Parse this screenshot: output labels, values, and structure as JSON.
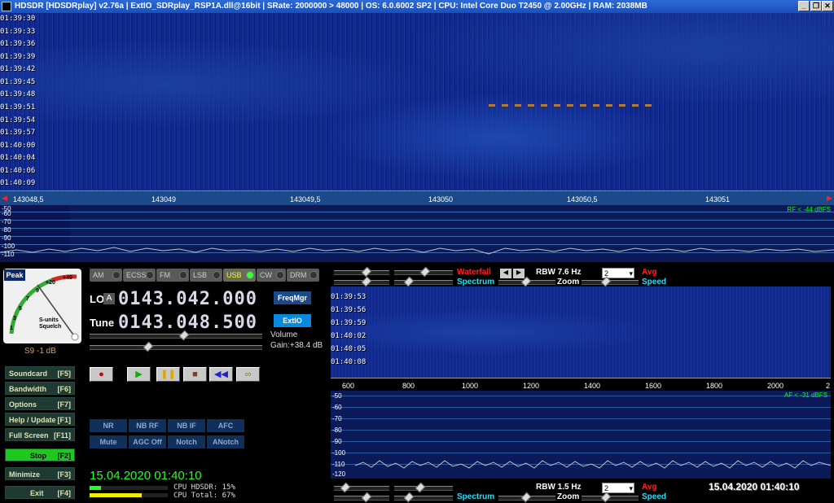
{
  "title": "HDSDR [HDSDRplay]  v2.76a  |  ExtIO_SDRplay_RSP1A.dll@16bit  |  SRate: 2000000 > 48000  |  OS: 6.0.6002 SP2  |  CPU: Intel Core Duo      T2450  @ 2.00GHz  |  RAM: 2038MB",
  "window_buttons": [
    "_",
    "❐",
    "✕"
  ],
  "waterfall_top": {
    "timestamps": [
      "01:39:30",
      "01:39:33",
      "01:39:36",
      "01:39:39",
      "01:39:42",
      "01:39:45",
      "01:39:48",
      "01:39:51",
      "01:39:54",
      "01:39:57",
      "01:40:00",
      "01:40:04",
      "01:40:06",
      "01:40:09"
    ]
  },
  "freq_axis": [
    "143048,5",
    "143049",
    "143049,5",
    "143050",
    "143050,5",
    "143051"
  ],
  "rf_spectrum": {
    "status": "RF < -44 dBFS",
    "db_labels": [
      "-50",
      "-60",
      "-70",
      "-80",
      "-90",
      "-100",
      "-110"
    ]
  },
  "meter": {
    "peak": "Peak",
    "scale": [
      "+40",
      "+20",
      "9",
      "7",
      "5",
      "3",
      "1"
    ],
    "label1": "S-units",
    "label2": "Squelch",
    "reading": "S9 -1 dB"
  },
  "side_buttons": [
    {
      "label": "Soundcard",
      "key": "[F5]"
    },
    {
      "label": "Bandwidth",
      "key": "[F6]"
    },
    {
      "label": "Options",
      "key": "[F7]"
    },
    {
      "label": "Help / Update",
      "key": "[F1]"
    },
    {
      "label": "Full Screen",
      "key": "[F11]"
    },
    {
      "label": "Stop",
      "key": "[F2]"
    },
    {
      "label": "Minimize",
      "key": "[F3]"
    },
    {
      "label": "Exit",
      "key": "[F4]"
    }
  ],
  "modes": [
    "AM",
    "ECSS",
    "FM",
    "LSB",
    "USB",
    "CW",
    "DRM"
  ],
  "lo": {
    "label": "LO",
    "tag": "A",
    "value": "0143.042.000"
  },
  "tune": {
    "label": "Tune",
    "value": "0143.048.500"
  },
  "freqmgr": "FreqMgr",
  "extio": "ExtIO",
  "volume": "Volume",
  "gain": "Gain:+38.4 dB",
  "transport": [
    "●",
    "▶",
    "❚❚",
    "■",
    "◀◀",
    "∞"
  ],
  "dsp_row1": [
    "NR",
    "NB RF",
    "NB IF",
    "AFC"
  ],
  "dsp_row2": [
    "Mute",
    "AGC Off",
    "Notch",
    "ANotch"
  ],
  "datetime": "15.04.2020 01:40:10",
  "cpu": {
    "hdsdr": "CPU HDSDR: 15%",
    "total": "CPU Total: 67%",
    "hdsdr_frac": 0.15,
    "total_frac": 0.67
  },
  "wf_ctrl_top": {
    "waterfall": "Waterfall",
    "spectrum": "Spectrum",
    "rbw": "RBW  7.6 Hz",
    "avg_value": "2",
    "avg": "Avg",
    "zoom": "Zoom",
    "speed": "Speed"
  },
  "waterfall_bot": {
    "timestamps": [
      "01:39:53",
      "01:39:56",
      "01:39:59",
      "01:40:02",
      "01:40:05",
      "01:40:08"
    ]
  },
  "af_axis": [
    "600",
    "800",
    "1000",
    "1200",
    "1400",
    "1600",
    "1800",
    "2000",
    "2"
  ],
  "af_spectrum": {
    "status": "AF < -31 dBFS",
    "db_labels": [
      "-50",
      "-60",
      "-70",
      "-80",
      "-90",
      "-100",
      "-110",
      "-120"
    ]
  },
  "wf_ctrl_bot": {
    "spectrum": "Spectrum",
    "rbw": "RBW  1.5 Hz",
    "avg_value": "2",
    "avg": "Avg",
    "zoom": "Zoom",
    "speed": "Speed"
  },
  "datetime_bottom": "15.04.2020  01:40:10"
}
